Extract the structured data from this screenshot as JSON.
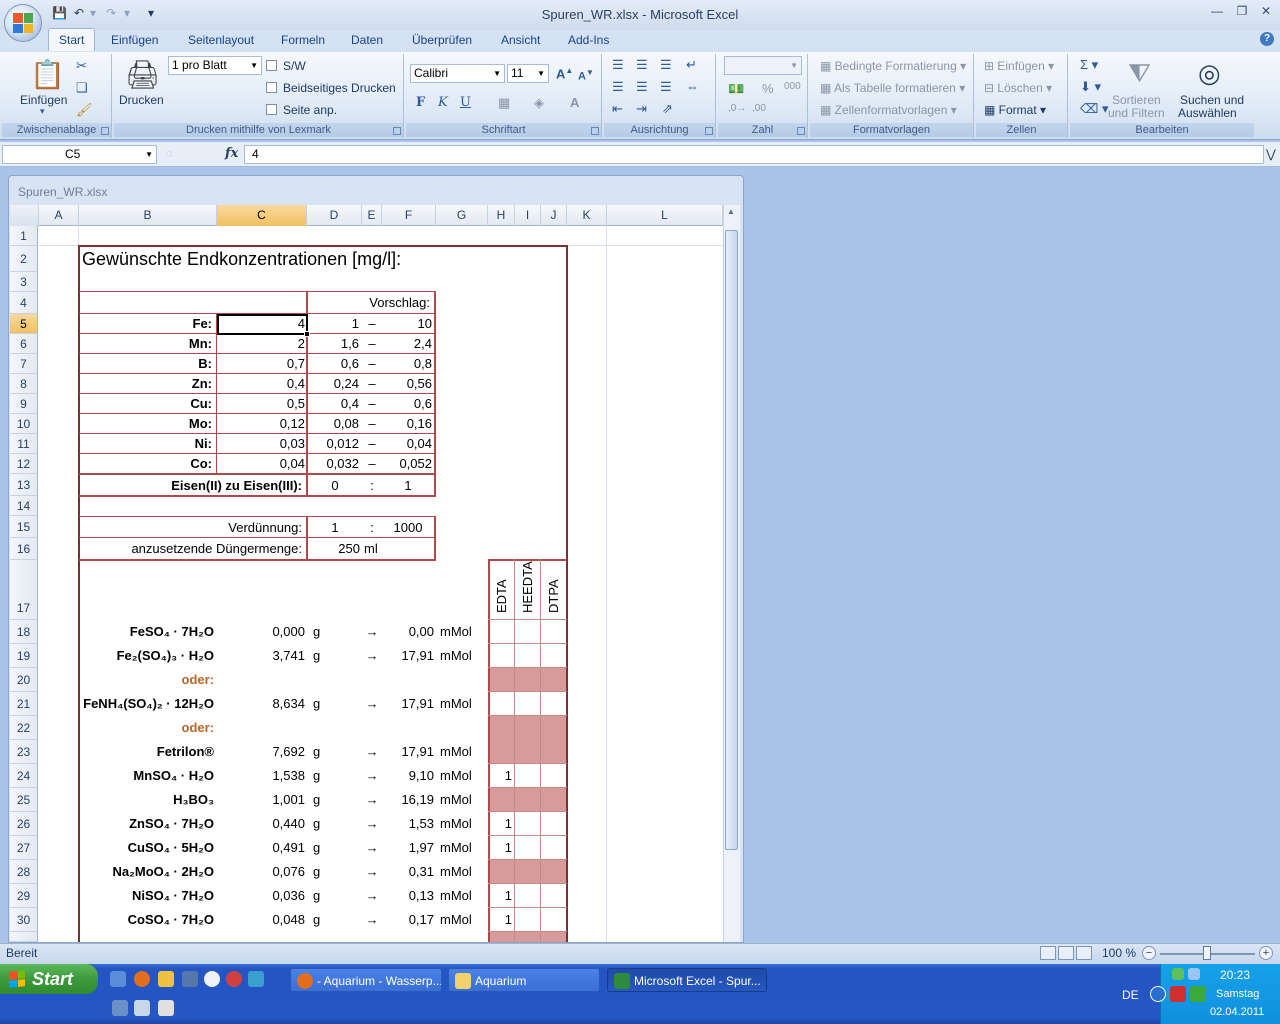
{
  "window": {
    "title": "Spuren_WR.xlsx - Microsoft Excel"
  },
  "ribbon": {
    "tabs": [
      "Start",
      "Einfügen",
      "Seitenlayout",
      "Formeln",
      "Daten",
      "Überprüfen",
      "Ansicht",
      "Add-Ins"
    ],
    "clipboard": {
      "paste": "Einfügen",
      "label": "Zwischenablage"
    },
    "print": {
      "print": "Drucken",
      "pages": "1 pro Blatt",
      "sw": "S/W",
      "duplex": "Beidseitiges Drucken",
      "fit": "Seite anp.",
      "label": "Drucken mithilfe von Lexmark"
    },
    "font": {
      "name": "Calibri",
      "size": "11",
      "label": "Schriftart"
    },
    "alignment": {
      "label": "Ausrichtung"
    },
    "number": {
      "label": "Zahl"
    },
    "styles": {
      "cond": "Bedingte Formatierung",
      "table": "Als Tabelle formatieren",
      "cell": "Zellenformatvorlagen",
      "label": "Formatvorlagen"
    },
    "cells": {
      "insert": "Einfügen",
      "delete": "Löschen",
      "format": "Format",
      "label": "Zellen"
    },
    "editing": {
      "sort1": "Sortieren",
      "sort2": "und Filtern",
      "find1": "Suchen und",
      "find2": "Auswählen",
      "label": "Bearbeiten"
    }
  },
  "formula_bar": {
    "cell": "C5",
    "value": "4"
  },
  "workbook": {
    "title": "Spuren_WR.xlsx"
  },
  "columns": [
    "A",
    "B",
    "C",
    "D",
    "E",
    "F",
    "G",
    "H",
    "I",
    "J",
    "K",
    "L"
  ],
  "rows": [
    "1",
    "2",
    "3",
    "4",
    "5",
    "6",
    "7",
    "8",
    "9",
    "10",
    "11",
    "12",
    "13",
    "14",
    "15",
    "16",
    "17",
    "18",
    "19",
    "20",
    "21",
    "22",
    "23",
    "24",
    "25",
    "26",
    "27",
    "28",
    "29",
    "30"
  ],
  "sheet": {
    "heading": "Gewünschte Endkonzentrationen [mg/l]:",
    "vorschlag": "Vorschlag:",
    "elements": [
      {
        "name": "Fe:",
        "value": "4",
        "min": "1",
        "dash": "–",
        "max": "10"
      },
      {
        "name": "Mn:",
        "value": "2",
        "min": "1,6",
        "dash": "–",
        "max": "2,4"
      },
      {
        "name": "B:",
        "value": "0,7",
        "min": "0,6",
        "dash": "–",
        "max": "0,8"
      },
      {
        "name": "Zn:",
        "value": "0,4",
        "min": "0,24",
        "dash": "–",
        "max": "0,56"
      },
      {
        "name": "Cu:",
        "value": "0,5",
        "min": "0,4",
        "dash": "–",
        "max": "0,6"
      },
      {
        "name": "Mo:",
        "value": "0,12",
        "min": "0,08",
        "dash": "–",
        "max": "0,16"
      },
      {
        "name": "Ni:",
        "value": "0,03",
        "min": "0,012",
        "dash": "–",
        "max": "0,04"
      },
      {
        "name": "Co:",
        "value": "0,04",
        "min": "0,032",
        "dash": "–",
        "max": "0,052"
      }
    ],
    "iron_ratio": {
      "label": "Eisen(II) zu Eisen(III):",
      "a": "0",
      "sep": ":",
      "b": "1"
    },
    "dilution": {
      "label": "Verdünnung:",
      "a": "1",
      "sep": ":",
      "b": "1000"
    },
    "fertilizer": {
      "label": "anzusetzende Düngermenge:",
      "value": "250",
      "unit": "ml"
    },
    "chelates": [
      "EDTA",
      "HEEDTA",
      "DTPA"
    ],
    "or_label": "oder:",
    "compounds": [
      {
        "mass": "0,000",
        "g": "g",
        "arrow": "→",
        "mmol": "0,00",
        "unit": "mMol",
        "edta": ""
      },
      {
        "mass": "3,741",
        "g": "g",
        "arrow": "→",
        "mmol": "17,91",
        "unit": "mMol",
        "edta": ""
      },
      {
        "mass": "8,634",
        "g": "g",
        "arrow": "→",
        "mmol": "17,91",
        "unit": "mMol",
        "edta": ""
      },
      {
        "mass": "7,692",
        "g": "g",
        "arrow": "→",
        "mmol": "17,91",
        "unit": "mMol",
        "edta": ""
      },
      {
        "mass": "1,538",
        "g": "g",
        "arrow": "→",
        "mmol": "9,10",
        "unit": "mMol",
        "edta": "1"
      },
      {
        "mass": "1,001",
        "g": "g",
        "arrow": "→",
        "mmol": "16,19",
        "unit": "mMol",
        "edta": ""
      },
      {
        "mass": "0,440",
        "g": "g",
        "arrow": "→",
        "mmol": "1,53",
        "unit": "mMol",
        "edta": "1"
      },
      {
        "mass": "0,491",
        "g": "g",
        "arrow": "→",
        "mmol": "1,97",
        "unit": "mMol",
        "edta": "1"
      },
      {
        "mass": "0,076",
        "g": "g",
        "arrow": "→",
        "mmol": "0,31",
        "unit": "mMol",
        "edta": ""
      },
      {
        "mass": "0,036",
        "g": "g",
        "arrow": "→",
        "mmol": "0,13",
        "unit": "mMol",
        "edta": "1"
      },
      {
        "mass": "0,048",
        "g": "g",
        "arrow": "→",
        "mmol": "0,17",
        "unit": "mMol",
        "edta": "1"
      }
    ],
    "compound_names": {
      "feso4": "FeSO₄ · 7H₂O",
      "fe2so4": "Fe₂(SO₄)₃ · H₂O",
      "fenh4": "FeNH₄(SO₄)₂ · 12H₂O",
      "fetrilon": "Fetrilon®",
      "mnso4": "MnSO₄ · H₂O",
      "h3bo3": "H₃BO₃",
      "znso4": "ZnSO₄ · 7H₂O",
      "cuso4": "CuSO₄ · 5H₂O",
      "na2moo4": "Na₂MoO₄ · 2H₂O",
      "niso4": "NiSO₄ · 7H₂O",
      "coso4": "CoSO₄ · 7H₂O"
    }
  },
  "status": {
    "text": "Bereit",
    "zoom": "100 %"
  },
  "taskbar": {
    "start": "Start",
    "items": [
      "- Aquarium - Wasserp...",
      "Aquarium",
      "Microsoft Excel - Spur..."
    ],
    "tray_lang": "DE",
    "time": "20:23",
    "day": "Samstag",
    "date": "02.04.2011"
  },
  "colors": {
    "table_border": "#b04a4a",
    "pink_fill": "#d89b9b",
    "selection": "#f1c15f",
    "taskbar": "#2456c4"
  }
}
